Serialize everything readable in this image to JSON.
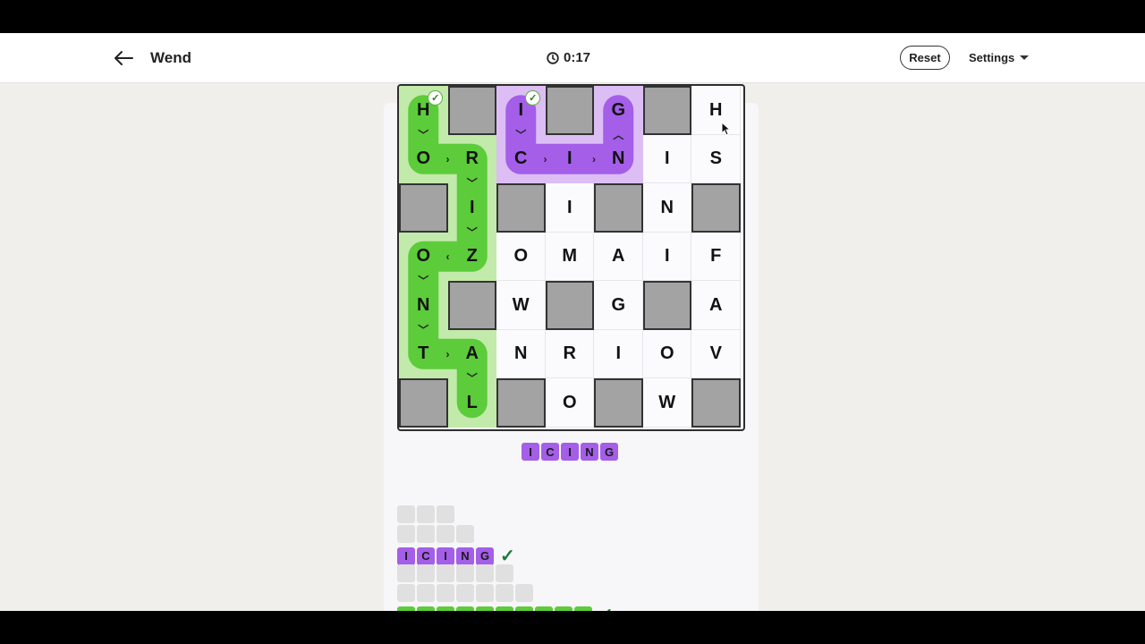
{
  "header": {
    "title": "Wend",
    "timer": "0:17",
    "reset_label": "Reset",
    "settings_label": "Settings"
  },
  "colors": {
    "green_path": "#5ccc3a",
    "green_region": "#c2eaaa",
    "purple_path": "#a45ee8",
    "purple_region": "#dcbef5",
    "block": "#a3a3a3"
  },
  "board": {
    "rows": 7,
    "cols": 7,
    "grid": [
      [
        "H",
        "#",
        "I",
        "#",
        "G",
        "#",
        "H"
      ],
      [
        "O",
        "R",
        "C",
        "I",
        "N",
        "I",
        "S"
      ],
      [
        "#",
        "I",
        "#",
        "I",
        "#",
        "N",
        "#"
      ],
      [
        "O",
        "Z",
        "O",
        "M",
        "A",
        "I",
        "F"
      ],
      [
        "N",
        "#",
        "W",
        "#",
        "G",
        "#",
        "A"
      ],
      [
        "T",
        "A",
        "N",
        "R",
        "I",
        "O",
        "V"
      ],
      [
        "#",
        "L",
        "#",
        "O",
        "#",
        "W",
        "#"
      ]
    ]
  },
  "current_word": [
    "I",
    "C",
    "I",
    "N",
    "G"
  ],
  "found_words": [
    {
      "letters": [
        "I",
        "C",
        "I",
        "N",
        "G"
      ],
      "check": "✓"
    }
  ]
}
